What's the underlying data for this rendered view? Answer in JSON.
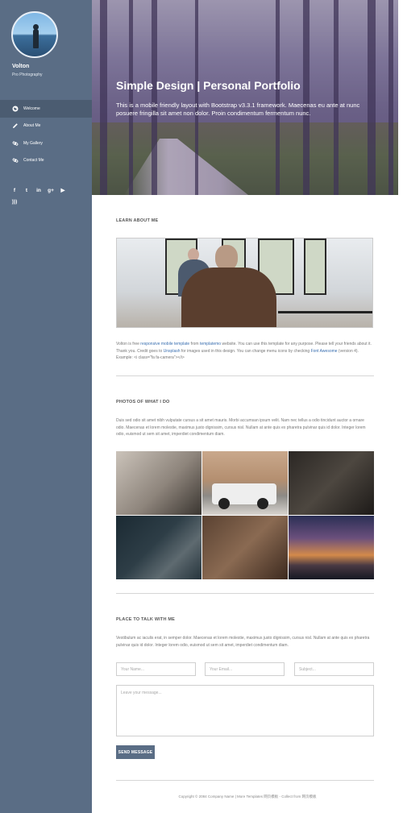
{
  "sidebar": {
    "brand": "Volton",
    "tagline": "Pro Photography",
    "nav": [
      {
        "label": "Welcome",
        "icon": "globe-icon",
        "active": true
      },
      {
        "label": "About Me",
        "icon": "pencil-icon",
        "active": false
      },
      {
        "label": "My Gallery",
        "icon": "link-icon",
        "active": false
      },
      {
        "label": "Contact Me",
        "icon": "link-icon",
        "active": false
      }
    ],
    "social": [
      {
        "glyph": "f",
        "icon": "facebook-icon"
      },
      {
        "glyph": "t",
        "icon": "twitter-icon"
      },
      {
        "glyph": "in",
        "icon": "linkedin-icon"
      },
      {
        "glyph": "g+",
        "icon": "google-plus-icon"
      },
      {
        "glyph": "▶",
        "icon": "youtube-icon"
      },
      {
        "glyph": ")))",
        "icon": "rss-icon"
      }
    ]
  },
  "hero": {
    "title": "Simple Design | Personal Portfolio",
    "subtitle": "This is a mobile friendly layout with Bootstrap v3.3.1 framework. Maecenas eu ante at nunc posuere fringilla sit amet non dolor. Proin condimentum fermentum nunc."
  },
  "about": {
    "title": "LEARN ABOUT ME",
    "text_1": "Volton is free ",
    "link_1": "responsive mobile template",
    "text_2": " from ",
    "link_2": "templatemo",
    "text_3": " website. You can use this template for any purpose. Please tell your friends about it. Thank you. Credit goes to ",
    "link_3": "Unsplash",
    "text_4": " for images used in this design. You can change menu icons by checking ",
    "link_4": "Font Awesome",
    "text_5": " (version 4). Example: <i class=\"fa fa-camera\"></i>"
  },
  "gallery": {
    "title": "PHOTOS OF WHAT I DO",
    "text": "Duis sed odio sit amet nibh vulputate cursus a sit amet mauris. Morbi accumsan ipsum velit. Nam nec tellus a odio tincidunt auctor a ornare odio. Maecenas et lorem molestie, maximus justo dignissim, cursus nisl. Nullam at ante quis ex pharetra pulvinar quis id dolor. Integer lorem odio, euismod ut sem sit amet, imperdiet condimentum diam."
  },
  "contact": {
    "title": "PLACE TO TALK WITH ME",
    "text": "Vestibulum ac iaculis erat, in semper dolor. Maecenas et lorem molestie, maximus justo dignissim, cursus nisl. Nullam at ante quis ex pharetra pulvinar quis id dolor. Integer lorem odio, euismod ut sem sit amet, imperdiet condimentum diam.",
    "name_placeholder": "Your Name...",
    "email_placeholder": "Your Email...",
    "subject_placeholder": "Subject...",
    "message_placeholder": "Leave your message...",
    "send_label": "SEND MESSAGE"
  },
  "footer": {
    "text": "Copyright © 2084 Company Name | More Templates 网页模板 - Collect from 网页模板"
  },
  "colors": {
    "sidebar": "#5a6d85",
    "sidebar_active": "#4b5c71",
    "link": "#3a6fb0"
  }
}
